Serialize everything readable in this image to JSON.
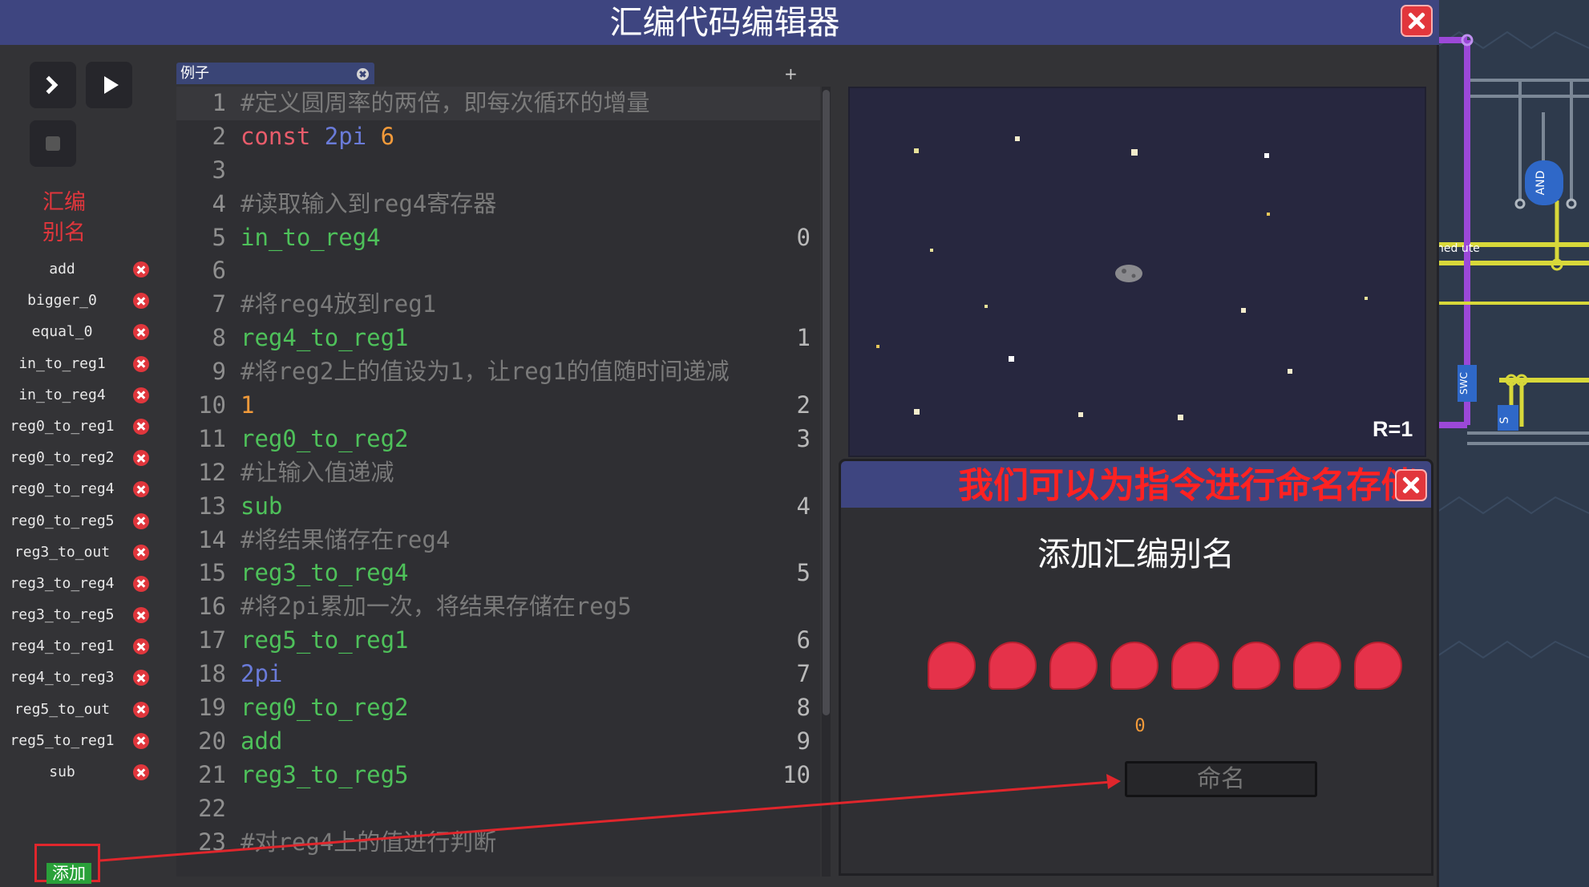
{
  "window": {
    "title": "汇编代码编辑器"
  },
  "toolbar": {
    "step_icon": "chevron-right-icon",
    "run_icon": "play-icon",
    "stop_icon": "stop-icon"
  },
  "alias_panel": {
    "heading_line1": "汇编",
    "heading_line2": "别名",
    "items": [
      {
        "label": "add"
      },
      {
        "label": "bigger_0"
      },
      {
        "label": "equal_0"
      },
      {
        "label": "in_to_reg1"
      },
      {
        "label": "in_to_reg4"
      },
      {
        "label": "reg0_to_reg1"
      },
      {
        "label": "reg0_to_reg2"
      },
      {
        "label": "reg0_to_reg4"
      },
      {
        "label": "reg0_to_reg5"
      },
      {
        "label": "reg3_to_out"
      },
      {
        "label": "reg3_to_reg4"
      },
      {
        "label": "reg3_to_reg5"
      },
      {
        "label": "reg4_to_reg1"
      },
      {
        "label": "reg4_to_reg3"
      },
      {
        "label": "reg5_to_out"
      },
      {
        "label": "reg5_to_reg1"
      },
      {
        "label": "sub"
      }
    ],
    "add_label": "添加"
  },
  "editor": {
    "tab_label": "例子",
    "tab_tools": "+<>",
    "lines": [
      {
        "n": "1",
        "parts": [
          {
            "t": "#定义圆周率的两倍，即每次循环的增量",
            "c": "comment"
          }
        ],
        "addr": ""
      },
      {
        "n": "2",
        "parts": [
          {
            "t": "const ",
            "c": "kw"
          },
          {
            "t": "2pi ",
            "c": "const"
          },
          {
            "t": "6",
            "c": "num"
          }
        ],
        "addr": ""
      },
      {
        "n": "3",
        "parts": [],
        "addr": ""
      },
      {
        "n": "4",
        "parts": [
          {
            "t": "#读取输入到reg4寄存器",
            "c": "comment"
          }
        ],
        "addr": ""
      },
      {
        "n": "5",
        "parts": [
          {
            "t": "in_to_reg4",
            "c": "ident"
          }
        ],
        "addr": "0"
      },
      {
        "n": "6",
        "parts": [],
        "addr": ""
      },
      {
        "n": "7",
        "parts": [
          {
            "t": "#将reg4放到reg1",
            "c": "comment"
          }
        ],
        "addr": ""
      },
      {
        "n": "8",
        "parts": [
          {
            "t": "reg4_to_reg1",
            "c": "ident"
          }
        ],
        "addr": "1"
      },
      {
        "n": "9",
        "parts": [
          {
            "t": "#将reg2上的值设为1，让reg1的值随时间递减",
            "c": "comment"
          }
        ],
        "addr": ""
      },
      {
        "n": "10",
        "parts": [
          {
            "t": "1",
            "c": "num"
          }
        ],
        "addr": "2"
      },
      {
        "n": "11",
        "parts": [
          {
            "t": "reg0_to_reg2",
            "c": "ident"
          }
        ],
        "addr": "3"
      },
      {
        "n": "12",
        "parts": [
          {
            "t": "#让输入值递减",
            "c": "comment"
          }
        ],
        "addr": ""
      },
      {
        "n": "13",
        "parts": [
          {
            "t": "sub",
            "c": "ident"
          }
        ],
        "addr": "4"
      },
      {
        "n": "14",
        "parts": [
          {
            "t": "#将结果储存在reg4",
            "c": "comment"
          }
        ],
        "addr": ""
      },
      {
        "n": "15",
        "parts": [
          {
            "t": "reg3_to_reg4",
            "c": "ident"
          }
        ],
        "addr": "5"
      },
      {
        "n": "16",
        "parts": [
          {
            "t": "#将2pi累加一次，将结果存储在reg5",
            "c": "comment"
          }
        ],
        "addr": ""
      },
      {
        "n": "17",
        "parts": [
          {
            "t": "reg5_to_reg1",
            "c": "ident"
          }
        ],
        "addr": "6"
      },
      {
        "n": "18",
        "parts": [
          {
            "t": "2pi",
            "c": "const"
          }
        ],
        "addr": "7"
      },
      {
        "n": "19",
        "parts": [
          {
            "t": "reg0_to_reg2",
            "c": "ident"
          }
        ],
        "addr": "8"
      },
      {
        "n": "20",
        "parts": [
          {
            "t": "add",
            "c": "ident"
          }
        ],
        "addr": "9"
      },
      {
        "n": "21",
        "parts": [
          {
            "t": "reg3_to_reg5",
            "c": "ident"
          }
        ],
        "addr": "10"
      },
      {
        "n": "22",
        "parts": [],
        "addr": ""
      },
      {
        "n": "23",
        "parts": [
          {
            "t": "#对reg4上的值进行判断",
            "c": "comment"
          }
        ],
        "addr": ""
      }
    ]
  },
  "preview": {
    "readout": "R=1"
  },
  "dialog": {
    "annotation": "我们可以为指令进行命名存储",
    "title": "添加汇编别名",
    "bit_count": 8,
    "value": "0",
    "name_placeholder": "命名"
  },
  "circuit": {
    "gate_and_label": "AND",
    "gate_swc_label": "SWC",
    "bus_label": "ned ute",
    "small_label_s": "S"
  },
  "colors": {
    "title_bar": "#3e4580",
    "close_button": "#e2363c",
    "alias_heading": "#e0363c",
    "comment": "#7a7a7a",
    "keyword": "#e95c6b",
    "identifier": "#4ec15a",
    "constant": "#6a7bd9",
    "number": "#f29a3a",
    "bit_on": "#e5324a",
    "add_button": "#2aa13a",
    "annotation": "#ff2222"
  }
}
